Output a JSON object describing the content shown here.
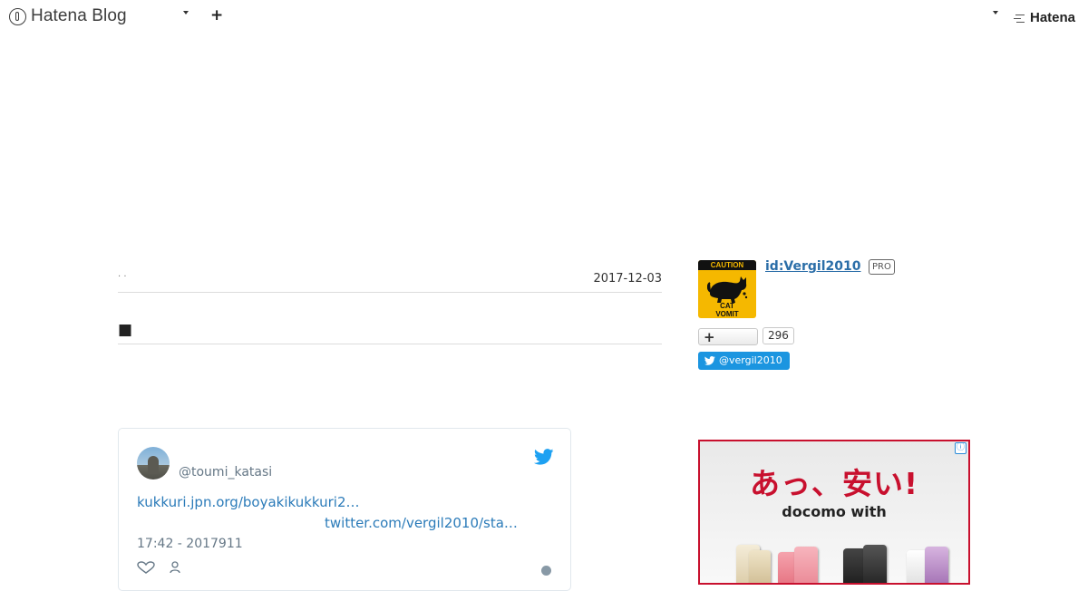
{
  "global_header": {
    "logo_text": "Hatena Blog",
    "right_logo_text": "Hatena"
  },
  "entry": {
    "date_prefix": "· ·",
    "date": "2017-12-03",
    "title": "■"
  },
  "tweet": {
    "handle": "@toumi_katasi",
    "link1": "kukkuri.jpn.org/boyakikukkuri2…",
    "link2": "twitter.com/vergil2010/sta…",
    "timestamp": "17:42 - 2017911"
  },
  "sidebar": {
    "profile_icon_top": "CAUTION",
    "profile_icon_bottom": "CAT\nVOMIT",
    "profile_id": "id:Vergil2010",
    "pro_badge": "PRO",
    "subscribe_count": "296",
    "twitter_follow": "@vergil2010"
  },
  "ad": {
    "headline": "あっ、安い!",
    "subheadline": "docomo with",
    "info_icon": "ⓘ"
  },
  "colors": {
    "link": "#2b7bb9",
    "twitter_blue": "#1b95e0",
    "ad_red": "#c8102e",
    "caution_yellow": "#f5b800"
  }
}
